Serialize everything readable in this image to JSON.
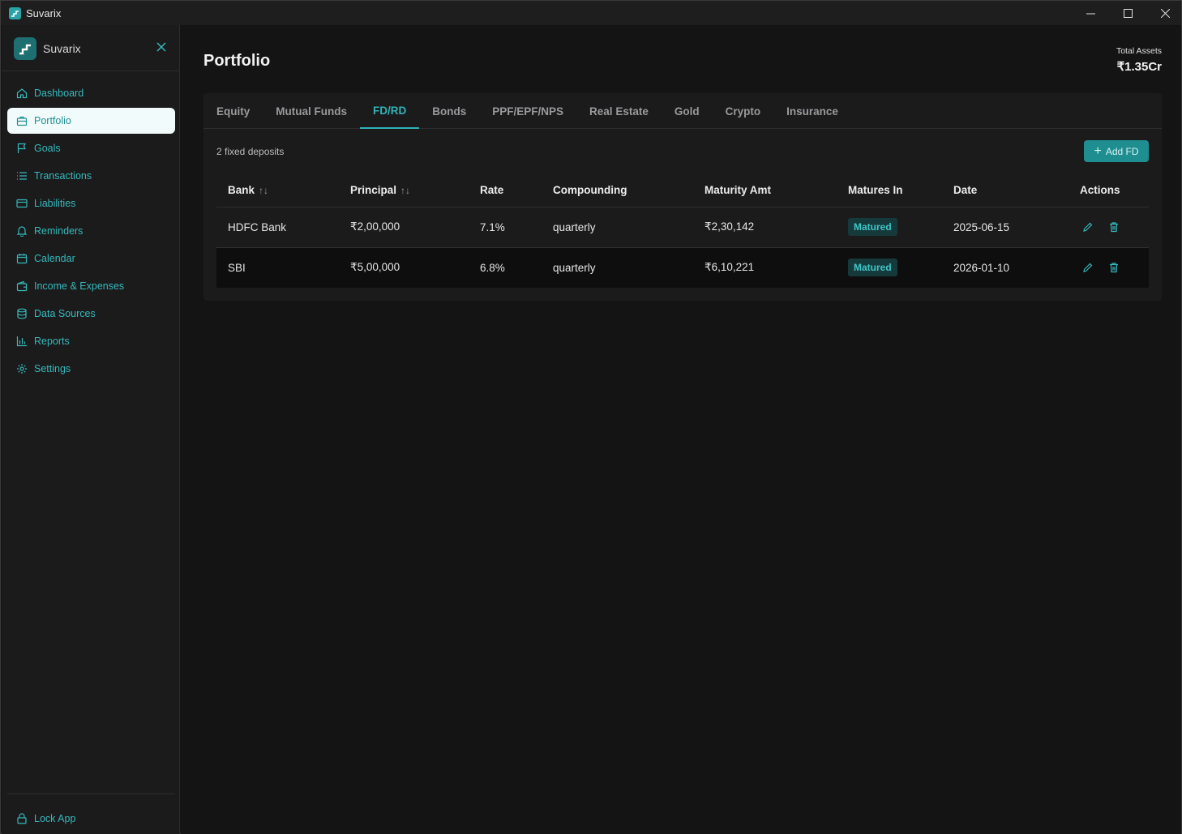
{
  "window": {
    "title": "Suvarix"
  },
  "sidebar": {
    "brand": "Suvarix",
    "items": [
      {
        "label": "Dashboard",
        "icon": "home-icon"
      },
      {
        "label": "Portfolio",
        "icon": "briefcase-icon",
        "active": true
      },
      {
        "label": "Goals",
        "icon": "flag-icon"
      },
      {
        "label": "Transactions",
        "icon": "list-icon"
      },
      {
        "label": "Liabilities",
        "icon": "credit-card-icon"
      },
      {
        "label": "Reminders",
        "icon": "bell-icon"
      },
      {
        "label": "Calendar",
        "icon": "calendar-icon"
      },
      {
        "label": "Income & Expenses",
        "icon": "wallet-icon"
      },
      {
        "label": "Data Sources",
        "icon": "database-icon"
      },
      {
        "label": "Reports",
        "icon": "bar-chart-icon"
      },
      {
        "label": "Settings",
        "icon": "gear-icon"
      }
    ],
    "lock_label": "Lock App"
  },
  "header": {
    "title": "Portfolio",
    "total_label": "Total Assets",
    "total_value": "₹1.35Cr"
  },
  "tabs": [
    "Equity",
    "Mutual Funds",
    "FD/RD",
    "Bonds",
    "PPF/EPF/NPS",
    "Real Estate",
    "Gold",
    "Crypto",
    "Insurance"
  ],
  "active_tab": "FD/RD",
  "section": {
    "count_text": "2 fixed deposits",
    "add_label": "Add FD"
  },
  "table": {
    "columns": [
      "Bank",
      "Principal",
      "Rate",
      "Compounding",
      "Maturity Amt",
      "Matures In",
      "Date",
      "Actions"
    ],
    "rows": [
      {
        "bank": "HDFC Bank",
        "principal": "₹2,00,000",
        "rate": "7.1%",
        "compounding": "quarterly",
        "maturity": "₹2,30,142",
        "status": "Matured",
        "date": "2025-06-15"
      },
      {
        "bank": "SBI",
        "principal": "₹5,00,000",
        "rate": "6.8%",
        "compounding": "quarterly",
        "maturity": "₹6,10,221",
        "status": "Matured",
        "date": "2026-01-10"
      }
    ]
  },
  "colors": {
    "accent": "#2fb3b6",
    "button": "#1f8e90",
    "badge_bg": "#163a3b"
  }
}
